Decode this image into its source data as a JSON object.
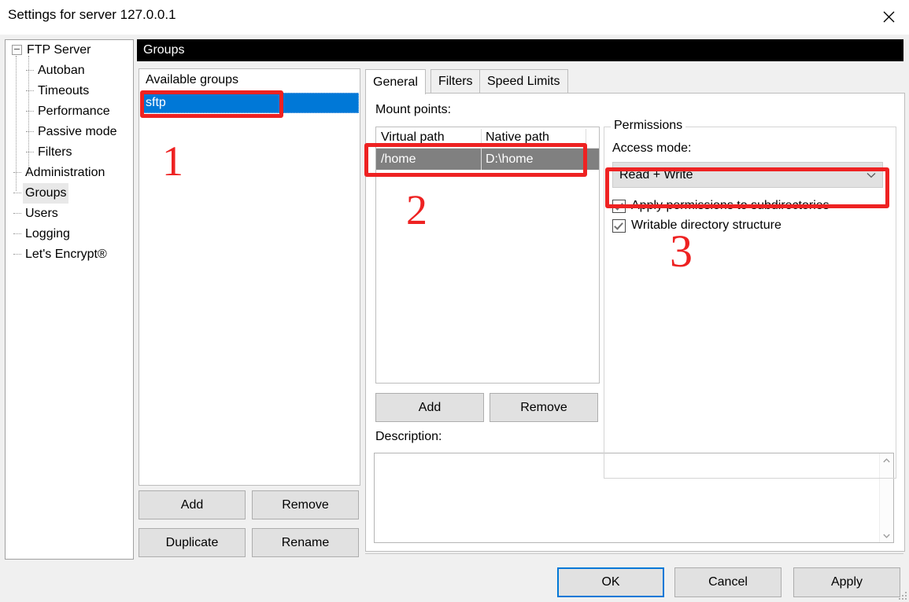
{
  "window": {
    "title": "Settings for server 127.0.0.1",
    "close_icon": "close-icon"
  },
  "sidebar": {
    "items": [
      {
        "label": "FTP Server",
        "level": 0,
        "expander": true,
        "selected": false
      },
      {
        "label": "Autoban",
        "level": 1,
        "expander": false,
        "selected": false
      },
      {
        "label": "Timeouts",
        "level": 1,
        "expander": false,
        "selected": false
      },
      {
        "label": "Performance",
        "level": 1,
        "expander": false,
        "selected": false
      },
      {
        "label": "Passive mode",
        "level": 1,
        "expander": false,
        "selected": false
      },
      {
        "label": "Filters",
        "level": 1,
        "expander": false,
        "selected": false
      },
      {
        "label": "Administration",
        "level": 0,
        "expander": false,
        "selected": false
      },
      {
        "label": "Groups",
        "level": 0,
        "expander": false,
        "selected": true
      },
      {
        "label": "Users",
        "level": 0,
        "expander": false,
        "selected": false
      },
      {
        "label": "Logging",
        "level": 0,
        "expander": false,
        "selected": false
      },
      {
        "label": "Let's Encrypt®",
        "level": 0,
        "expander": false,
        "selected": false
      }
    ]
  },
  "section": {
    "header": "Groups"
  },
  "groups": {
    "available_label": "Available groups",
    "items": [
      {
        "name": "sftp",
        "selected": true
      }
    ],
    "buttons": {
      "add": "Add",
      "remove": "Remove",
      "duplicate": "Duplicate",
      "rename": "Rename"
    }
  },
  "tabs": [
    {
      "label": "General",
      "active": true
    },
    {
      "label": "Filters",
      "active": false
    },
    {
      "label": "Speed Limits",
      "active": false
    }
  ],
  "general": {
    "mount_points_label": "Mount points:",
    "columns": [
      "Virtual path",
      "Native path"
    ],
    "rows": [
      {
        "virtual_path": "/home",
        "native_path": "D:\\home",
        "selected": true
      }
    ],
    "buttons": {
      "add": "Add",
      "remove": "Remove"
    },
    "description_label": "Description:",
    "description_value": "",
    "scroll_up_icon": "chevron-up-icon",
    "scroll_down_icon": "chevron-down-icon"
  },
  "permissions": {
    "legend": "Permissions",
    "access_mode_label": "Access mode:",
    "access_mode_value": "Read + Write",
    "access_mode_options": [
      "Read + Write"
    ],
    "dropdown_icon": "chevron-down-icon",
    "checkboxes": [
      {
        "label": "Apply permissions to subdirectories",
        "checked": true
      },
      {
        "label": "Writable directory structure",
        "checked": true
      }
    ]
  },
  "footer": {
    "ok": "OK",
    "cancel": "Cancel",
    "apply": "Apply"
  },
  "annotations": {
    "color": "#ee2222",
    "markers": [
      {
        "number": "1",
        "target": "selected-group-sftp"
      },
      {
        "number": "2",
        "target": "mount-point-row-home"
      },
      {
        "number": "3",
        "target": "access-mode-dropdown"
      }
    ]
  }
}
